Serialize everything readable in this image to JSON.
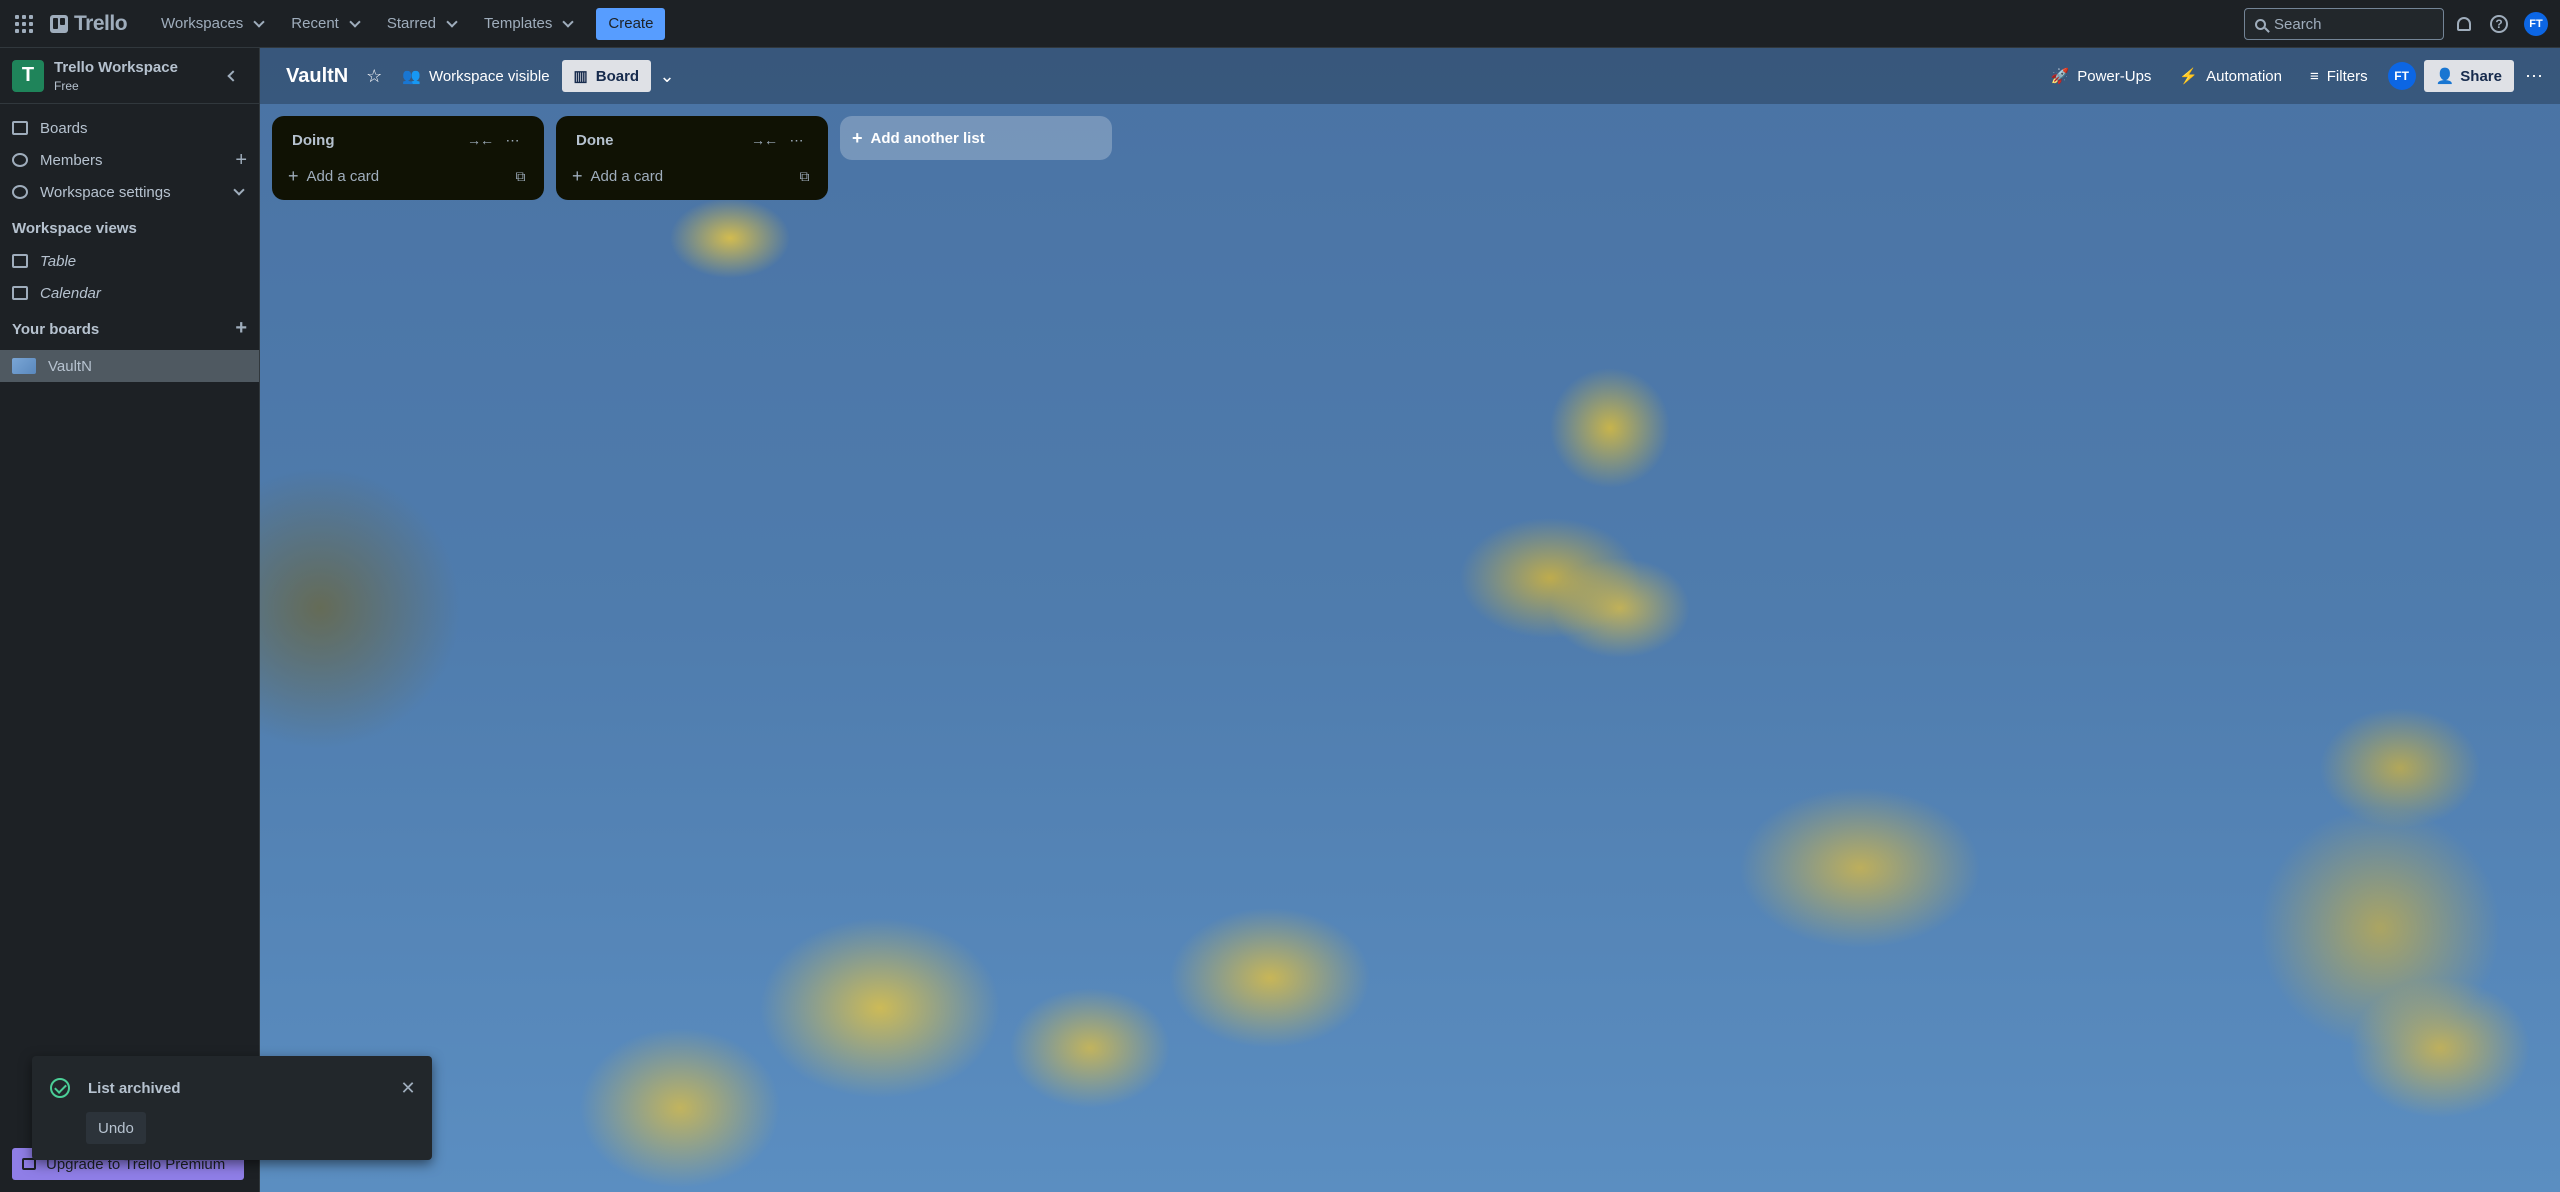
{
  "topnav": {
    "logo": "Trello",
    "menus": [
      "Workspaces",
      "Recent",
      "Starred",
      "Templates"
    ],
    "create": "Create",
    "search_placeholder": "Search",
    "avatar": "FT"
  },
  "sidebar": {
    "workspace_initial": "T",
    "workspace_name": "Trello Workspace",
    "workspace_plan": "Free",
    "items": [
      "Boards",
      "Members",
      "Workspace settings"
    ],
    "views_heading": "Workspace views",
    "views": [
      "Table",
      "Calendar"
    ],
    "boards_heading": "Your boards",
    "boards": [
      "VaultN"
    ],
    "upgrade": "Upgrade to Trello Premium"
  },
  "board": {
    "title": "VaultN",
    "visibility": "Workspace visible",
    "view": "Board",
    "right": {
      "powerups": "Power-Ups",
      "automation": "Automation",
      "filters": "Filters",
      "avatar": "FT",
      "share": "Share"
    },
    "lists": [
      {
        "title": "Doing",
        "add_card": "Add a card"
      },
      {
        "title": "Done",
        "add_card": "Add a card"
      }
    ],
    "add_list": "Add another list"
  },
  "toast": {
    "message": "List archived",
    "undo": "Undo"
  }
}
